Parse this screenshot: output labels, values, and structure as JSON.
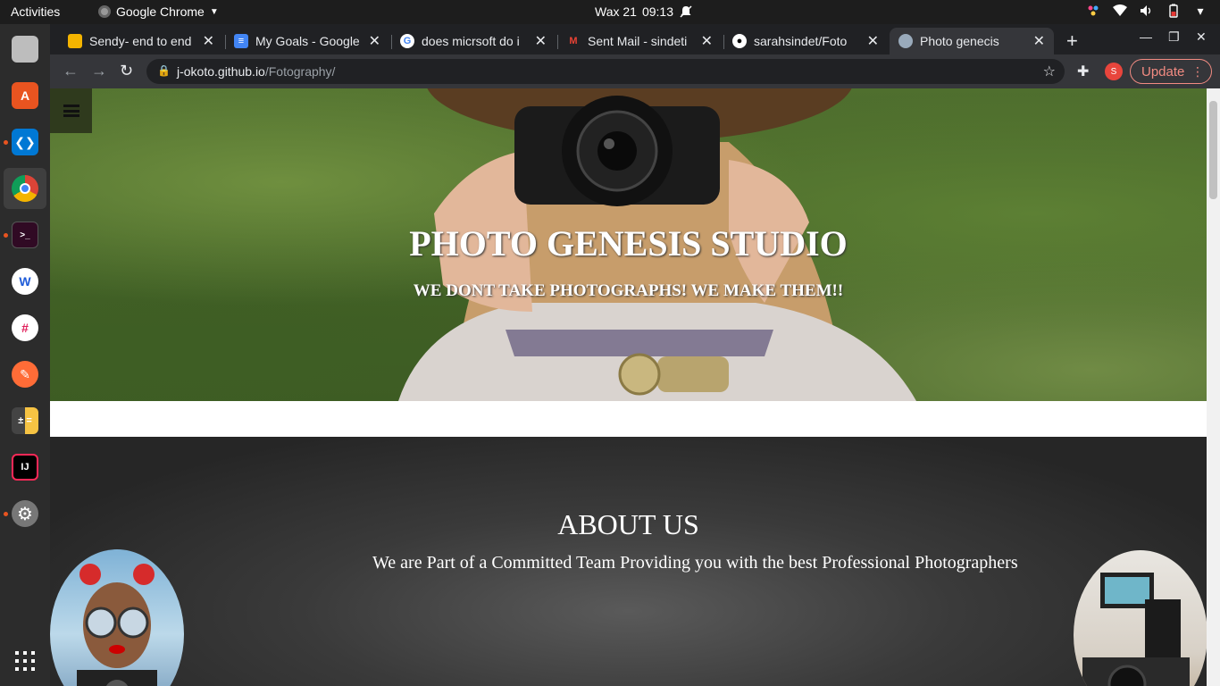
{
  "topbar": {
    "activities": "Activities",
    "app_name": "Google Chrome",
    "date": "Wax 21",
    "time": "09:13"
  },
  "dock": {
    "apps": [
      "files",
      "software-center",
      "vscode",
      "chrome",
      "terminal",
      "app-w",
      "slack",
      "postman",
      "calculator",
      "intellij",
      "settings",
      "show-apps"
    ]
  },
  "browser": {
    "tabs": [
      {
        "title": "Sendy- end to end",
        "icon": "slides-icon"
      },
      {
        "title": "My Goals - Google",
        "icon": "docs-icon"
      },
      {
        "title": "does micrsoft do i",
        "icon": "google-icon"
      },
      {
        "title": "Sent Mail - sindeti",
        "icon": "gmail-icon"
      },
      {
        "title": "sarahsindet/Foto",
        "icon": "github-icon"
      },
      {
        "title": "Photo genecis",
        "icon": "globe-icon"
      }
    ],
    "url_host": "j-okoto.github.io",
    "url_path": "/Fotography/",
    "profile_initial": "S",
    "update_label": "Update"
  },
  "page": {
    "hero_title": "PHOTO GENESIS STUDIO",
    "hero_subtitle": "WE DONT TAKE PHOTOGRAPHS! WE MAKE THEM!!",
    "about_title": "ABOUT US",
    "about_text": "We are Part of a Committed Team Providing you with the best Professional Photographers"
  },
  "colors": {
    "accent_update": "#f28b82",
    "dock_dot": "#e95420",
    "profile": "#e8453c"
  }
}
